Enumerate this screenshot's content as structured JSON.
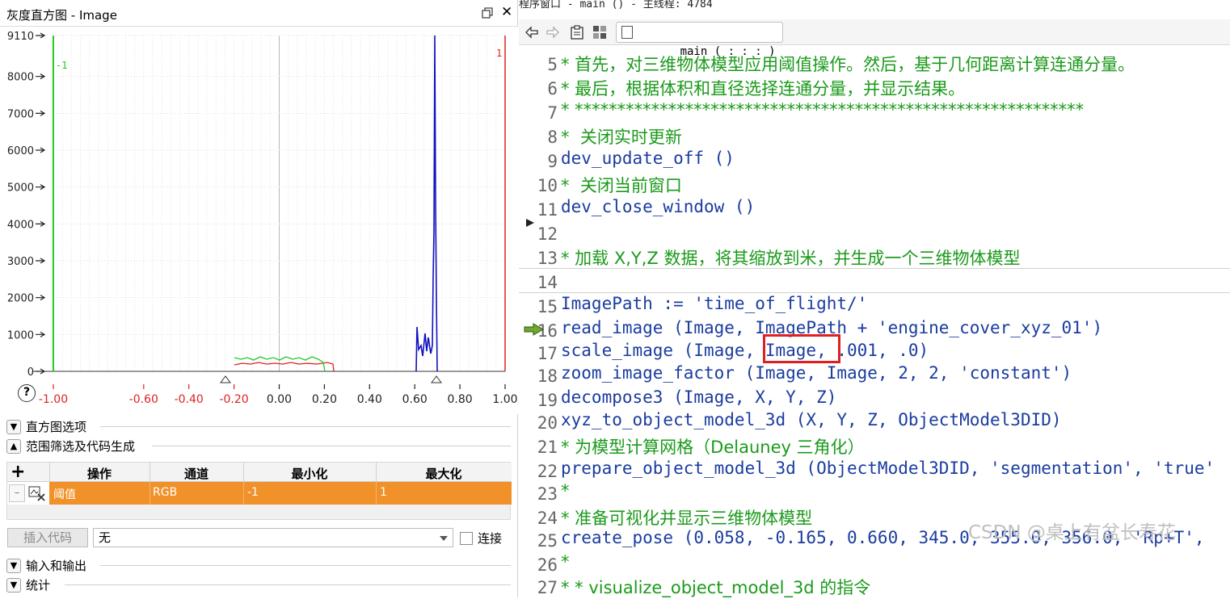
{
  "histogram_window": {
    "title": "灰度直方图 - Image",
    "y_ticks": [
      "9110",
      "8000",
      "7000",
      "6000",
      "5000",
      "4000",
      "3000",
      "2000",
      "1000",
      "0"
    ],
    "x_ticks": [
      "-1.00",
      "-0.60",
      "-0.40",
      "-0.20",
      "0.00",
      "0.20",
      "0.40",
      "0.60",
      "0.80",
      "1.00"
    ],
    "threshold_min_label": "-1",
    "threshold_max_label": "1",
    "help_glyph": "?",
    "colors": {
      "min_line": "#22cc22",
      "max_line": "#dd2222",
      "trace_blue": "#1010c0",
      "trace_green": "#22cc22",
      "trace_red": "#dd2222"
    },
    "sections": {
      "hist_options": "直方图选项",
      "range_filter": "范围筛选及代码生成",
      "io": "输入和输出",
      "stats": "统计"
    },
    "table": {
      "add": "+",
      "remove": "–",
      "headers": [
        "操作",
        "通道",
        "最小化",
        "最大化"
      ],
      "row": {
        "op": "阈值",
        "channel": "RGB",
        "min": "-1",
        "max": "1"
      },
      "row_color": "#f0912a"
    },
    "insert_code": "插入代码",
    "code_select": "无",
    "connect_label": "连接"
  },
  "histogram_data": {
    "type": "line",
    "ylim": [
      0,
      9110
    ],
    "xlim": [
      -1.0,
      1.0
    ],
    "peak_x": 0.69,
    "peak_y": 9110
  },
  "program_window": {
    "title": "程序窗口 - main () - 主线程: 4784",
    "procedure": "main ( : : : )",
    "watermark": "CSDN @桌上有盆长寿花",
    "lines": [
      {
        "n": "5",
        "text": "* 首先，对三维物体模型应用阈值操作。然后，基于几何距离计算连通分量。",
        "kind": "comment"
      },
      {
        "n": "6",
        "text": "* 最后，根据体积和直径选择连通分量，并显示结果。",
        "kind": "comment"
      },
      {
        "n": "7",
        "text": "* ************************************************************",
        "kind": "comment"
      },
      {
        "n": "8",
        "text": "*  关闭实时更新",
        "kind": "comment"
      },
      {
        "n": "9",
        "text": "dev_update_off ()",
        "kind": "code"
      },
      {
        "n": "10",
        "text": "*  关闭当前窗口",
        "kind": "comment"
      },
      {
        "n": "11",
        "text": "dev_close_window ()",
        "kind": "code"
      },
      {
        "n": "12",
        "text": "",
        "kind": "code"
      },
      {
        "n": "13",
        "text": "* 加载 X,Y,Z 数据，将其缩放到米，并生成一个三维物体模型",
        "kind": "comment"
      },
      {
        "n": "14",
        "text": "",
        "kind": "code"
      },
      {
        "n": "15",
        "text": "ImagePath := 'time_of_flight/'",
        "kind": "code"
      },
      {
        "n": "16",
        "text": "read_image (Image, ImagePath + 'engine_cover_xyz_01')",
        "kind": "code"
      },
      {
        "n": "17",
        "text": "scale_image (Image, Image, .001, .0)",
        "kind": "code"
      },
      {
        "n": "18",
        "text": "zoom_image_factor (Image, Image, 2, 2, 'constant')",
        "kind": "code"
      },
      {
        "n": "19",
        "text": "decompose3 (Image, X, Y, Z)",
        "kind": "code"
      },
      {
        "n": "20",
        "text": "xyz_to_object_model_3d (X, Y, Z, ObjectModel3DID)",
        "kind": "code"
      },
      {
        "n": "21",
        "text": "* 为模型计算网格（Delauney 三角化）",
        "kind": "comment"
      },
      {
        "n": "22",
        "text": "prepare_object_model_3d (ObjectModel3DID, 'segmentation', 'true'",
        "kind": "code"
      },
      {
        "n": "23",
        "text": "*",
        "kind": "comment"
      },
      {
        "n": "24",
        "text": "* 准备可视化并显示三维物体模型",
        "kind": "comment"
      },
      {
        "n": "25",
        "text": "create_pose (0.058, -0.165, 0.660, 345.0, 355.0, 356.0, 'Rp+T',",
        "kind": "code"
      },
      {
        "n": "26",
        "text": "*",
        "kind": "comment"
      },
      {
        "n": "27",
        "text": "* * visualize_object_model_3d 的指令",
        "kind": "comment"
      }
    ],
    "code_color": "#1a3c9f",
    "comment_color": "#1b9a1b"
  }
}
